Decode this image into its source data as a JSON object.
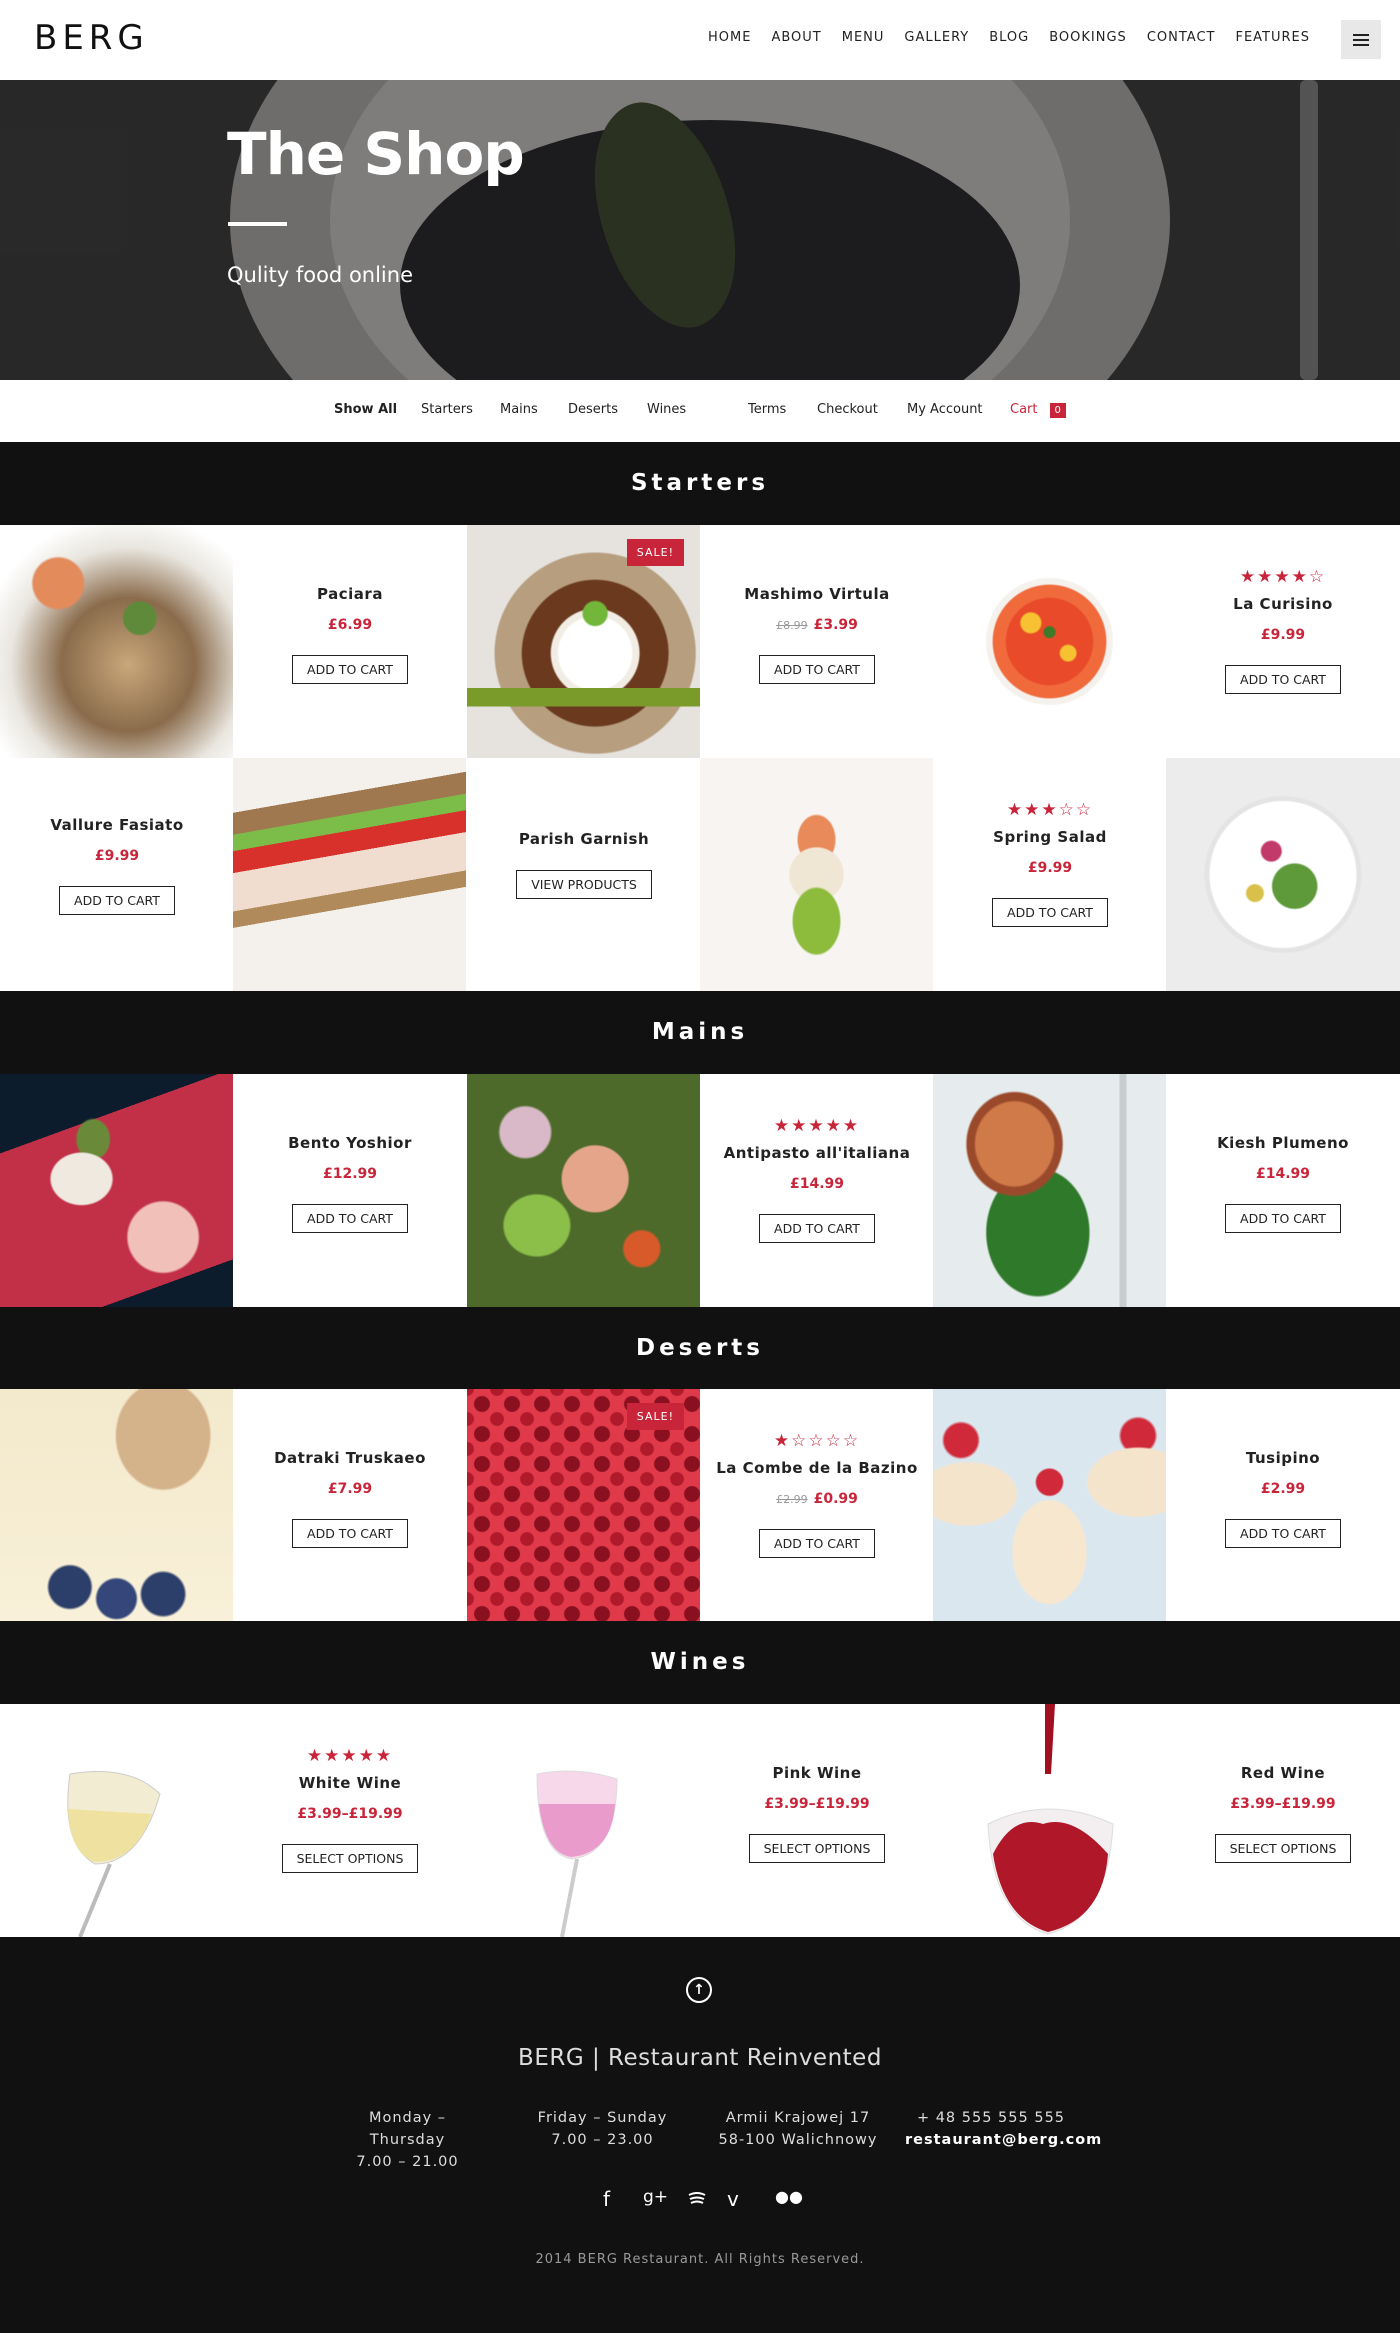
{
  "brand": {
    "logo": "BERG"
  },
  "nav": {
    "items": [
      "HOME",
      "ABOUT",
      "MENU",
      "GALLERY",
      "BLOG",
      "BOOKINGS",
      "CONTACT",
      "FEATURES"
    ],
    "menu_icon": "hamburger-icon"
  },
  "hero": {
    "title": "The Shop",
    "subtitle": "Qulity food online"
  },
  "filter": {
    "categories": [
      "Show All",
      "Starters",
      "Mains",
      "Deserts",
      "Wines"
    ],
    "links": [
      "Terms",
      "Checkout",
      "My Account"
    ],
    "cart_label": "Cart",
    "cart_count": "0"
  },
  "sections": {
    "starters": {
      "title": "Starters",
      "products": [
        {
          "name": "Paciara",
          "price": "£6.99",
          "button": "ADD TO CART"
        },
        {
          "name": "Mashimo Virtula",
          "old_price": "£8.99",
          "price": "£3.99",
          "button": "ADD TO CART",
          "sale": "SALE!"
        },
        {
          "name": "La Curisino",
          "price": "£9.99",
          "button": "ADD TO CART",
          "stars": "★★★★☆",
          "rating": 4
        },
        {
          "name": "Vallure Fasiato",
          "price": "£9.99",
          "button": "ADD TO CART"
        },
        {
          "name": "Parish Garnish",
          "button": "VIEW PRODUCTS"
        },
        {
          "name": "Spring Salad",
          "price": "£9.99",
          "button": "ADD TO CART",
          "stars": "★★★☆☆",
          "rating": 3
        }
      ]
    },
    "mains": {
      "title": "Mains",
      "products": [
        {
          "name": "Bento Yoshior",
          "price": "£12.99",
          "button": "ADD TO CART"
        },
        {
          "name": "Antipasto all'italiana",
          "price": "£14.99",
          "button": "ADD TO CART",
          "stars": "★★★★★",
          "rating": 5
        },
        {
          "name": "Kiesh Plumeno",
          "price": "£14.99",
          "button": "ADD TO CART"
        }
      ]
    },
    "deserts": {
      "title": "Deserts",
      "products": [
        {
          "name": "Datraki Truskaeo",
          "price": "£7.99",
          "button": "ADD TO CART"
        },
        {
          "name": "La Combe de la Bazino",
          "old_price": "£2.99",
          "price": "£0.99",
          "button": "ADD TO CART",
          "stars": "★☆☆☆☆",
          "rating": 1,
          "sale": "SALE!"
        },
        {
          "name": "Tusipino",
          "price": "£2.99",
          "button": "ADD TO CART"
        }
      ]
    },
    "wines": {
      "title": "Wines",
      "products": [
        {
          "name": "White Wine",
          "price": "£3.99–£19.99",
          "button": "SELECT OPTIONS",
          "stars": "★★★★★",
          "rating": 5
        },
        {
          "name": "Pink Wine",
          "price": "£3.99–£19.99",
          "button": "SELECT OPTIONS"
        },
        {
          "name": "Red Wine",
          "price": "£3.99–£19.99",
          "button": "SELECT OPTIONS"
        }
      ]
    }
  },
  "footer": {
    "title": "BERG | Restaurant Reinvented",
    "hours1": [
      "Monday – Thursday",
      "7.00 – 21.00"
    ],
    "hours2": [
      "Friday – Sunday",
      "7.00 – 23.00"
    ],
    "address": [
      "Armii Krajowej 17",
      "58-100 Walichnowy"
    ],
    "contact": [
      "+ 48 555 555 555",
      "restaurant@berg.com"
    ],
    "social": [
      "facebook-icon",
      "google-plus-icon",
      "spotify-icon",
      "vine-icon",
      "flickr-icon"
    ],
    "copyright": "2014 BERG Restaurant. All Rights Reserved."
  },
  "colors": {
    "accent": "#c9253a",
    "dark": "#111111"
  }
}
